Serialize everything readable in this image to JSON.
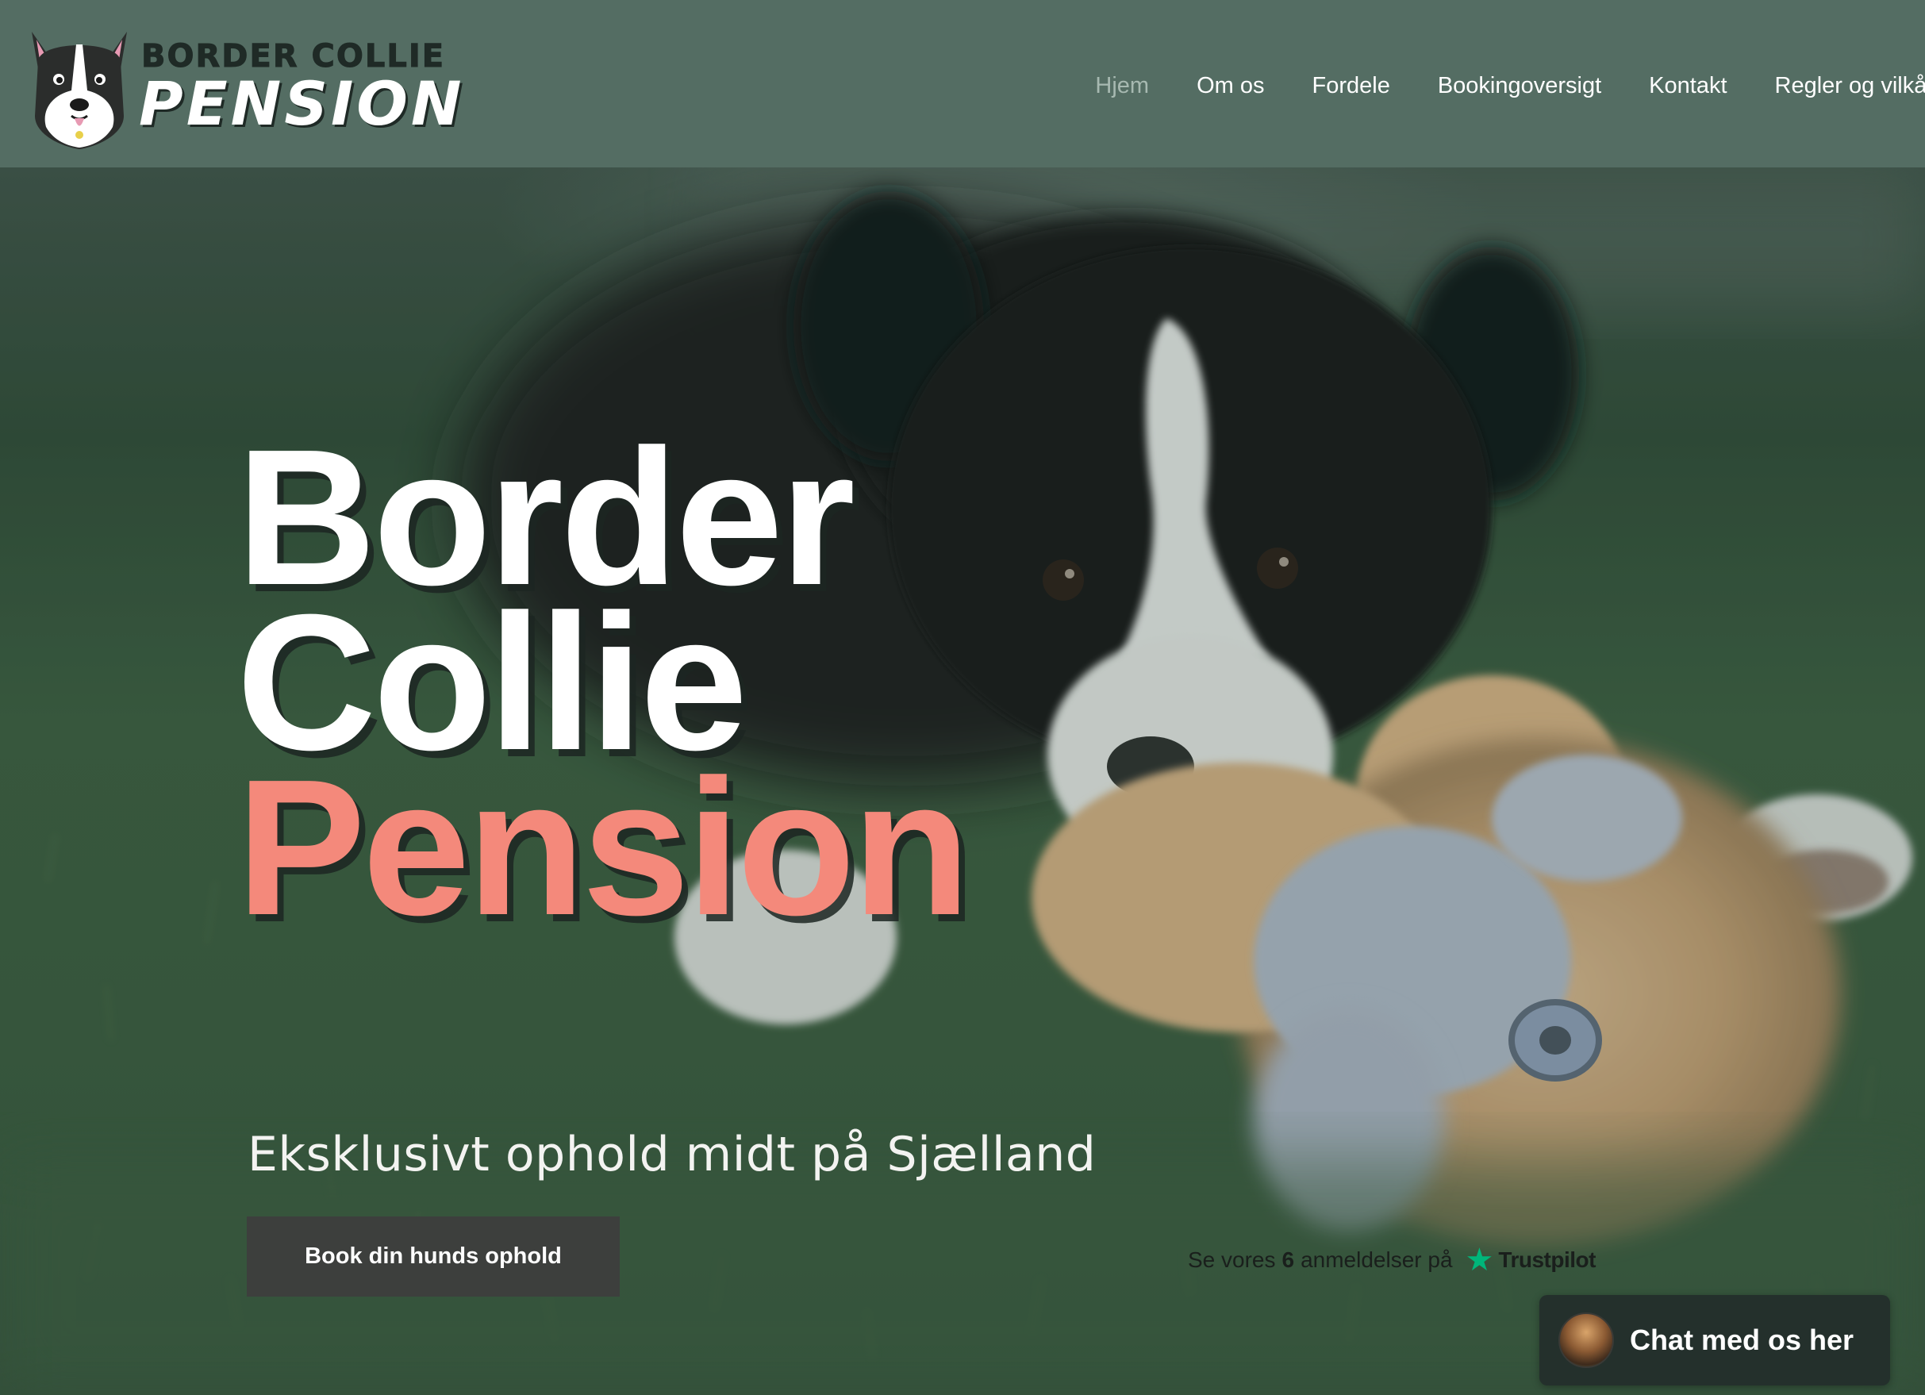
{
  "header": {
    "logo": {
      "line1": "BORDER COLLIE",
      "line2": "PENSION"
    },
    "nav": [
      {
        "label": "Hjem",
        "active": true
      },
      {
        "label": "Om os",
        "active": false
      },
      {
        "label": "Fordele",
        "active": false
      },
      {
        "label": "Bookingoversigt",
        "active": false
      },
      {
        "label": "Kontakt",
        "active": false
      },
      {
        "label": "Regler og vilkår",
        "active": false
      }
    ]
  },
  "hero": {
    "title_line1": "Border",
    "title_line2": "Collie",
    "title_line3": "Pension",
    "subtitle": "Eksklusivt ophold midt på Sjælland",
    "cta_label": "Book din hunds ophold"
  },
  "trustpilot": {
    "prefix": "Se vores",
    "count": "6",
    "suffix": "anmeldelser på",
    "brand": "Trustpilot",
    "star_icon": "star-icon"
  },
  "chat": {
    "label": "Chat med os her"
  },
  "colors": {
    "header_bg": "#546d63",
    "nav_active": "#a7b9b1",
    "accent_coral": "#f4897b",
    "button_bg": "#3d3f3d",
    "chat_bg": "#24302c",
    "trustpilot_green": "#00b67a"
  }
}
